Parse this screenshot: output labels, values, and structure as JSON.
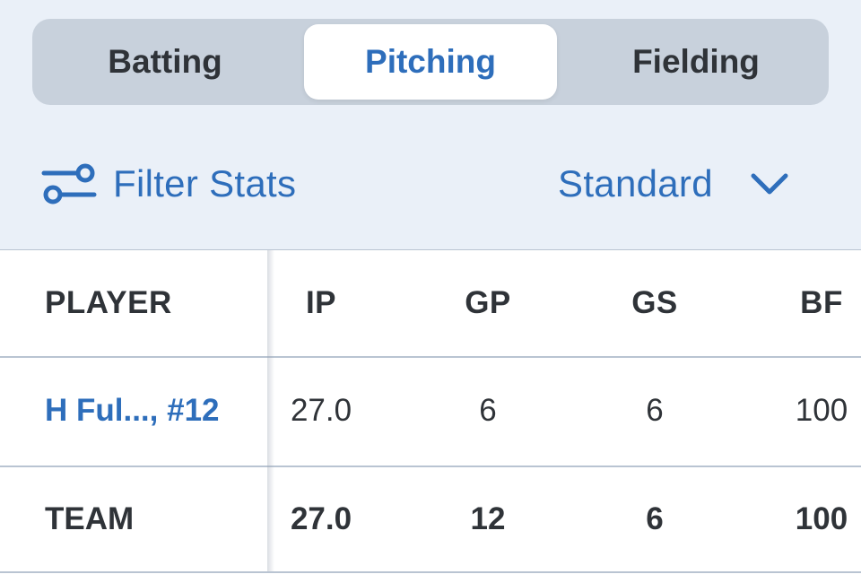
{
  "tabs": [
    {
      "label": "Batting",
      "active": false
    },
    {
      "label": "Pitching",
      "active": true
    },
    {
      "label": "Fielding",
      "active": false
    }
  ],
  "filter": {
    "label": "Filter Stats",
    "icon": "sliders-icon"
  },
  "view_select": {
    "value": "Standard",
    "icon": "chevron-down-icon"
  },
  "table": {
    "columns": [
      "PLAYER",
      "IP",
      "GP",
      "GS",
      "BF"
    ],
    "rows": [
      {
        "player": "H Ful..., #12",
        "ip": "27.0",
        "gp": "6",
        "gs": "6",
        "bf": "100"
      },
      {
        "player": "TEAM",
        "ip": "27.0",
        "gp": "12",
        "gs": "6",
        "bf": "100"
      }
    ]
  },
  "colors": {
    "accent": "#2e6ebb",
    "background": "#eaf0f8",
    "segment_track": "#c8d1dc",
    "text": "#2f3338",
    "divider": "#b9c4d2"
  }
}
